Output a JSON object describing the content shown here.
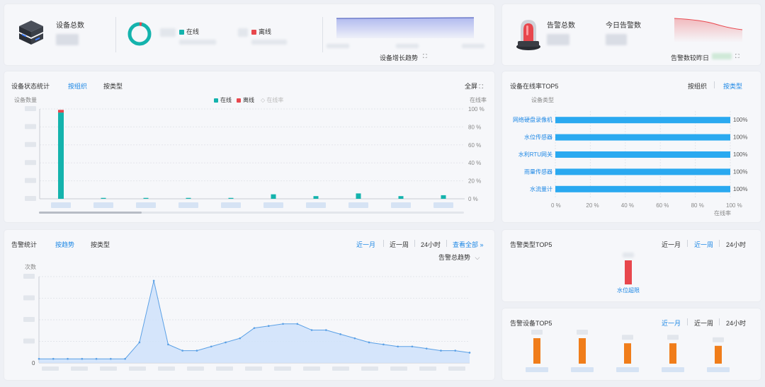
{
  "overview": {
    "device_total_label": "设备总数",
    "online_label": "在线",
    "offline_label": "离线",
    "growth_trend_label": "设备增长趋势",
    "colors": {
      "online": "#14b3ad",
      "offline": "#e8474d"
    }
  },
  "alarm_summary": {
    "alarm_total_label": "告警总数",
    "today_alarm_label": "今日告警数",
    "compare_label": "告警数较昨日"
  },
  "device_status": {
    "title": "设备状态统计",
    "tabs": [
      "按组织",
      "按类型"
    ],
    "active_tab": "按组织",
    "fullscreen_label": "全屏",
    "y_left_label": "设备数量",
    "y_right_label": "在线率",
    "legend": [
      "在线",
      "离线",
      "在线率"
    ],
    "right_ticks": [
      "100 %",
      "80 %",
      "60 %",
      "40 %",
      "20 %",
      "0 %"
    ]
  },
  "online_rate_top5": {
    "title": "设备在线率TOP5",
    "tabs": [
      "按组织",
      "按类型"
    ],
    "active_tab": "按类型",
    "axis_title": "设备类型",
    "x_axis_label": "在线率",
    "x_ticks": [
      "0 %",
      "20 %",
      "40 %",
      "60 %",
      "80 %",
      "100 %"
    ],
    "bar_color": "#2aa9f0"
  },
  "alarm_stats": {
    "title": "告警统计",
    "tabs": [
      "按趋势",
      "按类型"
    ],
    "active_tab": "按趋势",
    "range_tabs": [
      "近一月",
      "近一周",
      "24小时"
    ],
    "active_range": "近一月",
    "view_all_label": "查看全部",
    "dropdown_label": "告警总趋势",
    "y_label": "次数",
    "y_zero": "0"
  },
  "alarm_type_top5": {
    "title": "告警类型TOP5",
    "range_tabs": [
      "近一月",
      "近一周",
      "24小时"
    ],
    "active_range": "近一周",
    "bar_label": "水位超限"
  },
  "alarm_device_top5": {
    "title": "告警设备TOP5",
    "range_tabs": [
      "近一月",
      "近一周",
      "24小时"
    ],
    "active_range": "近一月"
  },
  "chart_data": [
    {
      "type": "bar",
      "title": "设备状态统计",
      "ylabel": "设备数量",
      "y2label": "在线率",
      "series": [
        {
          "name": "在线",
          "values": [
            96,
            1,
            1,
            1,
            1,
            5,
            3,
            6,
            3,
            4
          ]
        },
        {
          "name": "离线",
          "values": [
            3,
            0,
            0,
            0,
            0,
            0,
            0,
            0,
            0,
            0
          ]
        }
      ],
      "ylim": [
        0,
        100
      ]
    },
    {
      "type": "bar",
      "title": "设备在线率TOP5",
      "orientation": "horizontal",
      "categories": [
        "网络硬盘录像机",
        "水位传感器",
        "水利RTU网关",
        "雨量传感器",
        "水流量计"
      ],
      "values": [
        100,
        100,
        100,
        100,
        100
      ],
      "value_labels": [
        "100%",
        "100%",
        "100%",
        "100%",
        "100%"
      ],
      "xlim": [
        0,
        100
      ],
      "xlabel": "在线率",
      "ylabel": "设备类型"
    },
    {
      "type": "area",
      "title": "告警统计",
      "ylabel": "次数",
      "values": [
        2,
        2,
        2,
        2,
        2,
        2,
        2,
        10,
        40,
        9,
        6,
        6,
        8,
        10,
        12,
        17,
        18,
        19,
        19,
        16,
        16,
        14,
        12,
        10,
        9,
        8,
        8,
        7,
        6,
        6,
        5
      ],
      "ylim": [
        0,
        42
      ]
    },
    {
      "type": "bar",
      "title": "告警类型TOP5",
      "categories": [
        "水位超限"
      ],
      "values": [
        1
      ],
      "color": "#e8474d"
    },
    {
      "type": "bar",
      "title": "告警设备TOP5",
      "values": [
        10,
        10,
        8,
        8,
        7
      ],
      "color": "#f07d1a"
    }
  ]
}
